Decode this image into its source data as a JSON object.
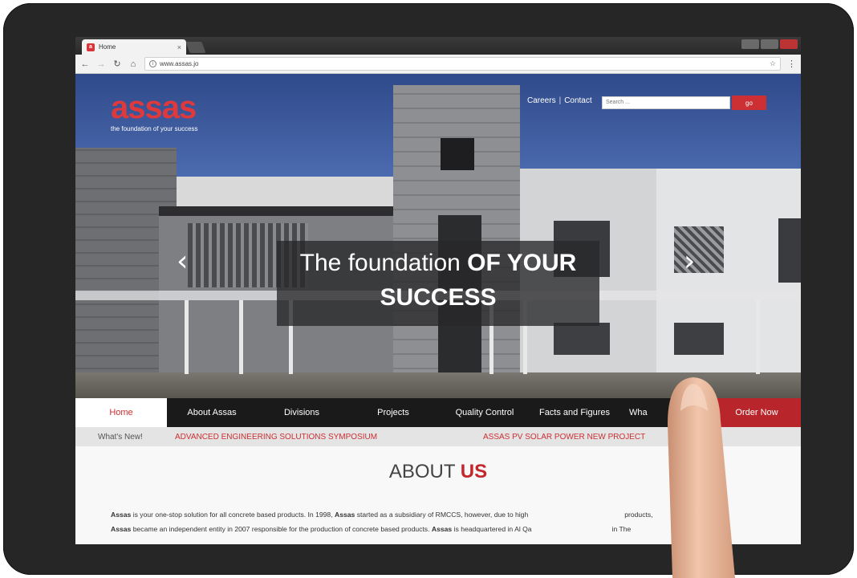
{
  "browser": {
    "tab_title": "Home",
    "favicon": "a",
    "url": "www.assas.jo"
  },
  "site": {
    "logo": "assas",
    "tagline": "the foundation of your success",
    "top_links": [
      "Careers",
      "Contact"
    ],
    "top_links_sep": "|",
    "search_placeholder": "Search ...",
    "search_button": "go",
    "brand_color": "#cc2f34"
  },
  "hero": {
    "caption_light": "The foundation",
    "caption_bold": "OF YOUR",
    "caption_line2": "SUCCESS",
    "prev_glyph": "‹",
    "next_glyph": "›"
  },
  "nav": {
    "items": [
      "Home",
      "About Assas",
      "Divisions",
      "Projects",
      "Quality Control",
      "Facts and Figures",
      "Wha"
    ],
    "order_button": "Order Now",
    "active_index": 0
  },
  "ticker": {
    "label": "What's New!",
    "items": [
      "ADVANCED ENGINEERING SOLUTIONS SYMPOSIUM",
      "ASSAS PV SOLAR POWER NEW PROJECT"
    ]
  },
  "about": {
    "title_light": "ABOUT",
    "title_bold": "US",
    "line1_brand": "Assas",
    "line1_text": " is your one-stop solution for all concrete based products. In 1998, ",
    "line1_brand2": "Assas",
    "line1_text2": " started as a subsidiary of RMCCS, however, due to high",
    "line1_tail": "products,",
    "line2_brand": "Assas",
    "line2_text": " became an independent entity in 2007 responsible for the production of concrete based products. ",
    "line2_brand2": "Assas",
    "line2_text2": " is headquartered in Al Qa",
    "line2_tail": "in The"
  }
}
